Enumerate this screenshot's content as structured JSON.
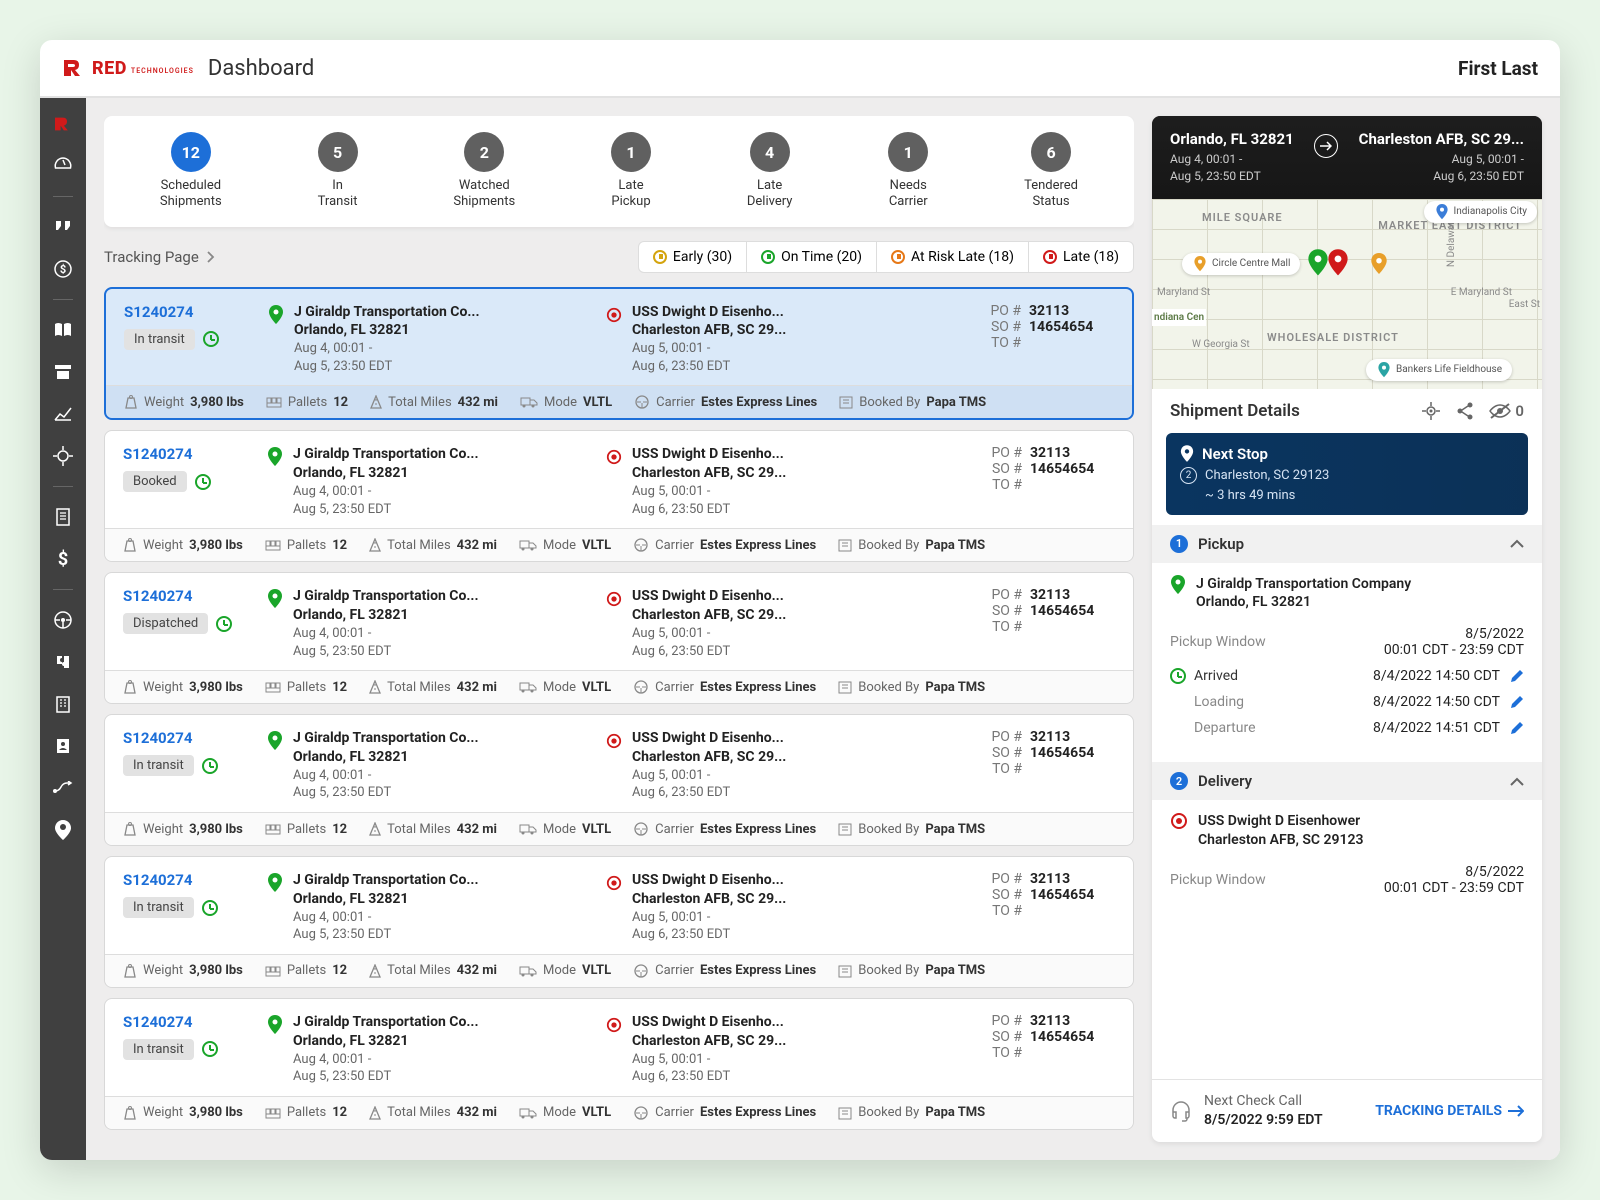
{
  "header": {
    "brand": "RED",
    "brand_sub": "TECHNOLOGIES",
    "page_title": "Dashboard",
    "user": "First Last"
  },
  "breadcrumb": "Tracking Page",
  "stats": [
    {
      "count": "12",
      "line1": "Scheduled",
      "line2": "Shipments",
      "primary": true
    },
    {
      "count": "5",
      "line1": "In",
      "line2": "Transit"
    },
    {
      "count": "2",
      "line1": "Watched",
      "line2": "Shipments"
    },
    {
      "count": "1",
      "line1": "Late",
      "line2": "Pickup"
    },
    {
      "count": "4",
      "line1": "Late",
      "line2": "Delivery"
    },
    {
      "count": "1",
      "line1": "Needs",
      "line2": "Carrier"
    },
    {
      "count": "6",
      "line1": "Tendered",
      "line2": "Status"
    }
  ],
  "filters": [
    {
      "label": "Early (30)",
      "color": "yellow"
    },
    {
      "label": "On Time (20)",
      "color": "green"
    },
    {
      "label": "At Risk Late (18)",
      "color": "orange"
    },
    {
      "label": "Late (18)",
      "color": "red"
    }
  ],
  "shipments": [
    {
      "id": "S1240274",
      "status": "In transit",
      "selected": true
    },
    {
      "id": "S1240274",
      "status": "Booked"
    },
    {
      "id": "S1240274",
      "status": "Dispatched"
    },
    {
      "id": "S1240274",
      "status": "In transit"
    },
    {
      "id": "S1240274",
      "status": "In transit"
    },
    {
      "id": "S1240274",
      "status": "In transit"
    }
  ],
  "ship_common": {
    "origin_name": "J Giraldp Transportation Co...",
    "origin_city": "Orlando, FL 32821",
    "origin_time1": "Aug 4, 00:01 -",
    "origin_time2": "Aug 5, 23:50 EDT",
    "dest_name": "USS Dwight D Eisenho...",
    "dest_city": "Charleston AFB, SC 29...",
    "dest_time1": "Aug 5, 00:01 -",
    "dest_time2": "Aug 6, 23:50 EDT",
    "refs": {
      "po_label": "PO #",
      "po": "32113",
      "so_label": "SO #",
      "so": "14654654",
      "to_label": "TO #",
      "to": ""
    },
    "meta": {
      "weight_label": "Weight",
      "weight": "3,980 lbs",
      "pallets_label": "Pallets",
      "pallets": "12",
      "miles_label": "Total Miles",
      "miles": "432 mi",
      "mode_label": "Mode",
      "mode": "VLTL",
      "carrier_label": "Carrier",
      "carrier": "Estes Express Lines",
      "booked_label": "Booked By",
      "booked": "Papa TMS"
    }
  },
  "details": {
    "origin_title": "Orlando, FL 32821",
    "origin_t1": "Aug 4, 00:01 -",
    "origin_t2": "Aug 5, 23:50 EDT",
    "dest_title": "Charleston AFB, SC 29...",
    "dest_t1": "Aug 5, 00:01 -",
    "dest_t2": "Aug 6, 23:50 EDT",
    "section_title": "Shipment Details",
    "watch_count": "0",
    "nextstop": {
      "title": "Next Stop",
      "city": "Charleston, SC 29123",
      "eta": "~ 3 hrs 49 mins",
      "num": "2"
    },
    "pickup": {
      "head": "Pickup",
      "num": "1",
      "company": "J Giraldp Transportation Company",
      "city": "Orlando, FL 32821",
      "window_label": "Pickup Window",
      "window_date": "8/5/2022",
      "window_time": "00:01 CDT - 23:59 CDT",
      "arr_label": "Arrived",
      "arr_val": "8/4/2022 14:50 CDT",
      "load_label": "Loading",
      "load_val": "8/4/2022 14:50 CDT",
      "dep_label": "Departure",
      "dep_val": "8/4/2022 14:51 CDT"
    },
    "delivery": {
      "head": "Delivery",
      "num": "2",
      "company": "USS Dwight D Eisenhower",
      "city": "Charleston AFB, SC 29123",
      "window_label": "Pickup Window",
      "window_date": "8/5/2022",
      "window_time": "00:01 CDT - 23:59 CDT"
    },
    "footer": {
      "label": "Next Check Call",
      "time": "8/5/2022 9:59 EDT",
      "link": "TRACKING DETAILS"
    }
  },
  "map": {
    "mile_square": "MILE SQUARE",
    "market_east": "MARKET EAST DISTRICT",
    "wholesale": "WHOLESALE DISTRICT",
    "circle_centre": "Circle Centre Mall",
    "indy_city": "Indianapolis City",
    "lucas": "Bankers Life Fieldhouse",
    "maryland": "Maryland St",
    "emland": "E Maryland St",
    "georgia": "W Georgia St",
    "delaware": "N Delaware St",
    "east_st": "East St",
    "diana": "ndiana Cen"
  }
}
